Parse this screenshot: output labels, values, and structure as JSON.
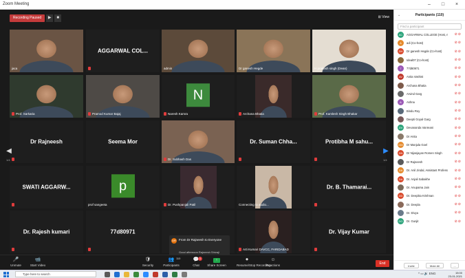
{
  "window": {
    "title": "Zoom Meeting",
    "controls": [
      "–",
      "□",
      "×"
    ]
  },
  "meeting": {
    "recording_label": "Recording Paused",
    "view_label": "⊞ View",
    "page_left": "1/4",
    "page_right": "1/4",
    "tiles": [
      {
        "name": "jaca",
        "text": "",
        "type": "video",
        "muted": false
      },
      {
        "name": "",
        "text": "AGGARWAL COL...",
        "type": "text",
        "muted": true
      },
      {
        "name": "admin",
        "text": "",
        "type": "video",
        "muted": false
      },
      {
        "name": "Dr ganesh Hegde",
        "text": "",
        "type": "video",
        "muted": false,
        "highlight": true
      },
      {
        "name": "H prakash singh (Dean)",
        "text": "",
        "type": "video",
        "muted": false
      },
      {
        "name": "Prof. Sarkaria",
        "text": "",
        "type": "video",
        "muted": true
      },
      {
        "name": "Pramod Kumar Bajaj",
        "text": "",
        "type": "video",
        "muted": true
      },
      {
        "name": "Naresh Kamra",
        "text": "N",
        "type": "avatar",
        "muted": true
      },
      {
        "name": "Archana Bhatia",
        "text": "",
        "type": "photo",
        "muted": true
      },
      {
        "name": "Prof. Kamlesh Singh Bhakar",
        "text": "",
        "type": "video",
        "muted": true
      },
      {
        "name": "",
        "text": "Dr Rajneesh",
        "type": "text",
        "muted": true
      },
      {
        "name": "",
        "text": "Seema Mor",
        "type": "text",
        "muted": false
      },
      {
        "name": "Dr. Subhash Das",
        "text": "",
        "type": "video",
        "muted": true
      },
      {
        "name": "",
        "text": "Dr. Suman Chha...",
        "type": "text",
        "muted": true
      },
      {
        "name": "",
        "text": "Protibha M sahu...",
        "type": "text",
        "muted": true
      },
      {
        "name": "",
        "text": "SWATI AGGARW...",
        "type": "text",
        "muted": true
      },
      {
        "name": "prof sangeeta",
        "text": "p",
        "type": "avatar",
        "muted": false
      },
      {
        "name": "Dr. Pushpanjali Patil",
        "text": "",
        "type": "photo",
        "muted": true
      },
      {
        "name": "Connecting to audio...",
        "text": "",
        "type": "photo",
        "muted": false
      },
      {
        "name": "",
        "text": "Dr. B. Thamarai...",
        "type": "text",
        "muted": true
      },
      {
        "name": "",
        "text": "Dr. Rajesh kumari",
        "type": "text",
        "muted": true
      },
      {
        "name": "",
        "text": "77d80971",
        "type": "text",
        "muted": true
      },
      {
        "name": "",
        "text": "",
        "type": "blank",
        "muted": false
      },
      {
        "name": "Arti Kumari DAVCC, FARIDABAD",
        "text": "",
        "type": "photo",
        "muted": true
      },
      {
        "name": "",
        "text": "Dr. Vijay Kumar",
        "type": "text",
        "muted": true
      }
    ],
    "chat_popup": {
      "initials": "DR",
      "from": "From Dr Rajneesh to Everyone",
      "message": "Good afternoon Rajneesh Shivaji college Delhi University"
    }
  },
  "toolbar": {
    "items": [
      {
        "label": "Unmute",
        "icon": "🎤"
      },
      {
        "label": "Start Video",
        "icon": "📹"
      },
      {
        "label": "Security",
        "icon": "🛡"
      },
      {
        "label": "Participants",
        "icon": "👥",
        "count": "110"
      },
      {
        "label": "Chat",
        "icon": "💬",
        "badge": "1"
      },
      {
        "label": "Share Screen",
        "icon": "↑"
      },
      {
        "label": "Resume/Stop Recording",
        "icon": "⏺"
      },
      {
        "label": "Reactions",
        "icon": "☺"
      }
    ],
    "end_label": "End"
  },
  "participants": {
    "title": "Participants (110)",
    "search_placeholder": "Find a participant",
    "list": [
      {
        "initials": "AC",
        "name": "AGGARWAL COLLEGE (Host, me)",
        "color": "#2ba37a"
      },
      {
        "initials": "A",
        "name": "adi (Co-host)",
        "color": "#e58a2c"
      },
      {
        "initials": "DH",
        "name": "Dr ganesh Hegde (Co-host)",
        "color": "#d9492b"
      },
      {
        "initials": "",
        "name": "Ideal07 (Co-host)",
        "color": "#8a6a3d"
      },
      {
        "initials": "7",
        "name": "77d80971",
        "color": "#9b59b6"
      },
      {
        "initials": "AV",
        "name": "Anita Vashist",
        "color": "#c0392b"
      },
      {
        "initials": "",
        "name": "Archana Bhatia",
        "color": "#7d5a4a"
      },
      {
        "initials": "",
        "name": "Arvind Garg",
        "color": "#6a6a6a"
      },
      {
        "initials": "A",
        "name": "Ashna",
        "color": "#9b59b6"
      },
      {
        "initials": "",
        "name": "Bindu Roy",
        "color": "#5a6a7a"
      },
      {
        "initials": "",
        "name": "Deepti Goyal Garg",
        "color": "#7a5a5a"
      },
      {
        "initials": "DV",
        "name": "Devananda Vanreani",
        "color": "#2ba37a"
      },
      {
        "initials": "",
        "name": "Dr Anita",
        "color": "#8a7a6a"
      },
      {
        "initials": "DM",
        "name": "Dr Manjula Goel",
        "color": "#e58a2c"
      },
      {
        "initials": "DN",
        "name": "Dr Nijanjayan Romen Singh",
        "color": "#d9492b"
      },
      {
        "initials": "",
        "name": "Dr Rajneesh",
        "color": "#5a5a5a"
      },
      {
        "initials": "DA",
        "name": "Dr. Anil Jindal, Assistant Professor",
        "color": "#e58a2c"
      },
      {
        "initials": "DA",
        "name": "Dr. Anjali Sabakhe",
        "color": "#d9492b"
      },
      {
        "initials": "",
        "name": "Dr. Anupama Jain",
        "color": "#7a6a5a"
      },
      {
        "initials": "DD",
        "name": "Dr. Deepika Krishnan",
        "color": "#d9492b"
      },
      {
        "initials": "",
        "name": "Dr. Deepla",
        "color": "#8a6a5a"
      },
      {
        "initials": "",
        "name": "Dr. Divya",
        "color": "#6a7a8a"
      },
      {
        "initials": "DG",
        "name": "Dr. Gunjit",
        "color": "#2ba37a"
      }
    ],
    "invite_label": "Invite",
    "mute_all_label": "Mute All",
    "more_label": "..."
  },
  "taskbar": {
    "search_placeholder": "Type here to search",
    "time": "15:00",
    "date": "23-01-2021",
    "lang": "ENG"
  }
}
